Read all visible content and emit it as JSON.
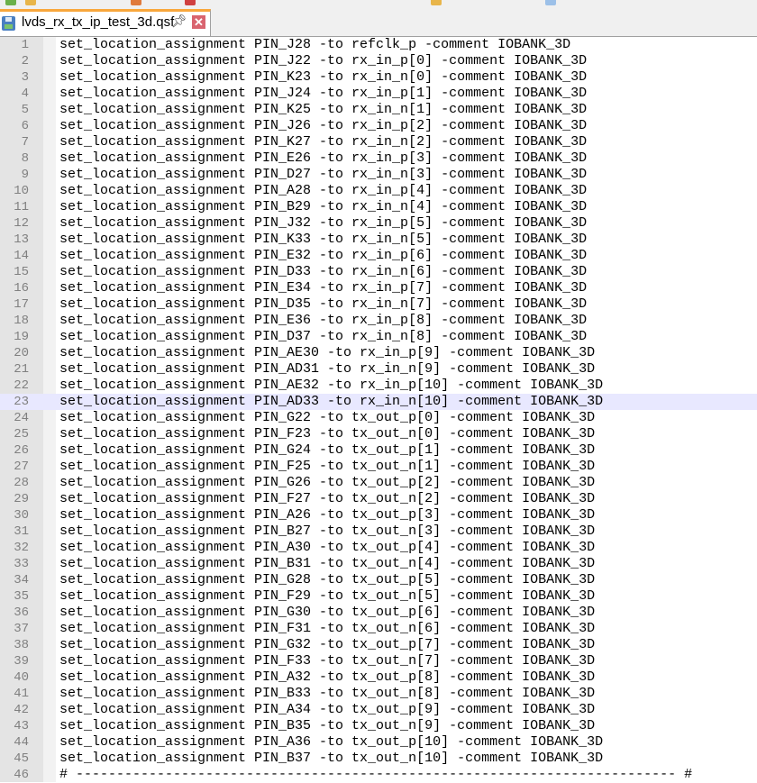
{
  "tab": {
    "title": "lvds_rx_tx_ip_test_3d.qsf",
    "active_color": "#f9a73c"
  },
  "current_line": 23,
  "lines": [
    "set_location_assignment PIN_J28 -to refclk_p -comment IOBANK_3D",
    "set_location_assignment PIN_J22 -to rx_in_p[0] -comment IOBANK_3D",
    "set_location_assignment PIN_K23 -to rx_in_n[0] -comment IOBANK_3D",
    "set_location_assignment PIN_J24 -to rx_in_p[1] -comment IOBANK_3D",
    "set_location_assignment PIN_K25 -to rx_in_n[1] -comment IOBANK_3D",
    "set_location_assignment PIN_J26 -to rx_in_p[2] -comment IOBANK_3D",
    "set_location_assignment PIN_K27 -to rx_in_n[2] -comment IOBANK_3D",
    "set_location_assignment PIN_E26 -to rx_in_p[3] -comment IOBANK_3D",
    "set_location_assignment PIN_D27 -to rx_in_n[3] -comment IOBANK_3D",
    "set_location_assignment PIN_A28 -to rx_in_p[4] -comment IOBANK_3D",
    "set_location_assignment PIN_B29 -to rx_in_n[4] -comment IOBANK_3D",
    "set_location_assignment PIN_J32 -to rx_in_p[5] -comment IOBANK_3D",
    "set_location_assignment PIN_K33 -to rx_in_n[5] -comment IOBANK_3D",
    "set_location_assignment PIN_E32 -to rx_in_p[6] -comment IOBANK_3D",
    "set_location_assignment PIN_D33 -to rx_in_n[6] -comment IOBANK_3D",
    "set_location_assignment PIN_E34 -to rx_in_p[7] -comment IOBANK_3D",
    "set_location_assignment PIN_D35 -to rx_in_n[7] -comment IOBANK_3D",
    "set_location_assignment PIN_E36 -to rx_in_p[8] -comment IOBANK_3D",
    "set_location_assignment PIN_D37 -to rx_in_n[8] -comment IOBANK_3D",
    "set_location_assignment PIN_AE30 -to rx_in_p[9] -comment IOBANK_3D",
    "set_location_assignment PIN_AD31 -to rx_in_n[9] -comment IOBANK_3D",
    "set_location_assignment PIN_AE32 -to rx_in_p[10] -comment IOBANK_3D",
    "set_location_assignment PIN_AD33 -to rx_in_n[10] -comment IOBANK_3D",
    "set_location_assignment PIN_G22 -to tx_out_p[0] -comment IOBANK_3D",
    "set_location_assignment PIN_F23 -to tx_out_n[0] -comment IOBANK_3D",
    "set_location_assignment PIN_G24 -to tx_out_p[1] -comment IOBANK_3D",
    "set_location_assignment PIN_F25 -to tx_out_n[1] -comment IOBANK_3D",
    "set_location_assignment PIN_G26 -to tx_out_p[2] -comment IOBANK_3D",
    "set_location_assignment PIN_F27 -to tx_out_n[2] -comment IOBANK_3D",
    "set_location_assignment PIN_A26 -to tx_out_p[3] -comment IOBANK_3D",
    "set_location_assignment PIN_B27 -to tx_out_n[3] -comment IOBANK_3D",
    "set_location_assignment PIN_A30 -to tx_out_p[4] -comment IOBANK_3D",
    "set_location_assignment PIN_B31 -to tx_out_n[4] -comment IOBANK_3D",
    "set_location_assignment PIN_G28 -to tx_out_p[5] -comment IOBANK_3D",
    "set_location_assignment PIN_F29 -to tx_out_n[5] -comment IOBANK_3D",
    "set_location_assignment PIN_G30 -to tx_out_p[6] -comment IOBANK_3D",
    "set_location_assignment PIN_F31 -to tx_out_n[6] -comment IOBANK_3D",
    "set_location_assignment PIN_G32 -to tx_out_p[7] -comment IOBANK_3D",
    "set_location_assignment PIN_F33 -to tx_out_n[7] -comment IOBANK_3D",
    "set_location_assignment PIN_A32 -to tx_out_p[8] -comment IOBANK_3D",
    "set_location_assignment PIN_B33 -to tx_out_n[8] -comment IOBANK_3D",
    "set_location_assignment PIN_A34 -to tx_out_p[9] -comment IOBANK_3D",
    "set_location_assignment PIN_B35 -to tx_out_n[9] -comment IOBANK_3D",
    "set_location_assignment PIN_A36 -to tx_out_p[10] -comment IOBANK_3D",
    "set_location_assignment PIN_B37 -to tx_out_n[10] -comment IOBANK_3D",
    "# -------------------------------------------------------------------------- #"
  ]
}
